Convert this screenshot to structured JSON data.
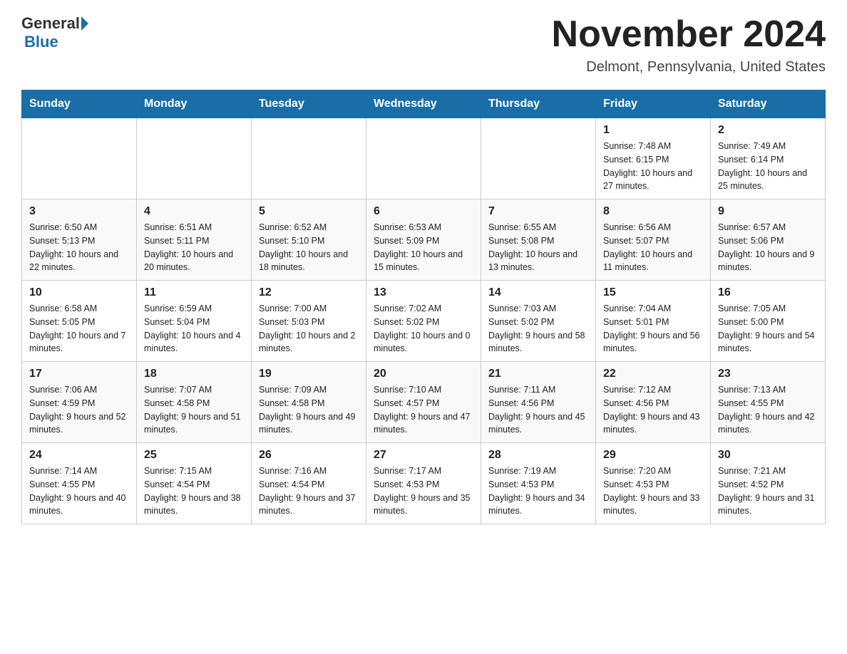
{
  "header": {
    "logo_general": "General",
    "logo_blue": "Blue",
    "month_title": "November 2024",
    "location": "Delmont, Pennsylvania, United States"
  },
  "days_of_week": [
    "Sunday",
    "Monday",
    "Tuesday",
    "Wednesday",
    "Thursday",
    "Friday",
    "Saturday"
  ],
  "weeks": [
    [
      {
        "day": "",
        "info": ""
      },
      {
        "day": "",
        "info": ""
      },
      {
        "day": "",
        "info": ""
      },
      {
        "day": "",
        "info": ""
      },
      {
        "day": "",
        "info": ""
      },
      {
        "day": "1",
        "info": "Sunrise: 7:48 AM\nSunset: 6:15 PM\nDaylight: 10 hours and 27 minutes."
      },
      {
        "day": "2",
        "info": "Sunrise: 7:49 AM\nSunset: 6:14 PM\nDaylight: 10 hours and 25 minutes."
      }
    ],
    [
      {
        "day": "3",
        "info": "Sunrise: 6:50 AM\nSunset: 5:13 PM\nDaylight: 10 hours and 22 minutes."
      },
      {
        "day": "4",
        "info": "Sunrise: 6:51 AM\nSunset: 5:11 PM\nDaylight: 10 hours and 20 minutes."
      },
      {
        "day": "5",
        "info": "Sunrise: 6:52 AM\nSunset: 5:10 PM\nDaylight: 10 hours and 18 minutes."
      },
      {
        "day": "6",
        "info": "Sunrise: 6:53 AM\nSunset: 5:09 PM\nDaylight: 10 hours and 15 minutes."
      },
      {
        "day": "7",
        "info": "Sunrise: 6:55 AM\nSunset: 5:08 PM\nDaylight: 10 hours and 13 minutes."
      },
      {
        "day": "8",
        "info": "Sunrise: 6:56 AM\nSunset: 5:07 PM\nDaylight: 10 hours and 11 minutes."
      },
      {
        "day": "9",
        "info": "Sunrise: 6:57 AM\nSunset: 5:06 PM\nDaylight: 10 hours and 9 minutes."
      }
    ],
    [
      {
        "day": "10",
        "info": "Sunrise: 6:58 AM\nSunset: 5:05 PM\nDaylight: 10 hours and 7 minutes."
      },
      {
        "day": "11",
        "info": "Sunrise: 6:59 AM\nSunset: 5:04 PM\nDaylight: 10 hours and 4 minutes."
      },
      {
        "day": "12",
        "info": "Sunrise: 7:00 AM\nSunset: 5:03 PM\nDaylight: 10 hours and 2 minutes."
      },
      {
        "day": "13",
        "info": "Sunrise: 7:02 AM\nSunset: 5:02 PM\nDaylight: 10 hours and 0 minutes."
      },
      {
        "day": "14",
        "info": "Sunrise: 7:03 AM\nSunset: 5:02 PM\nDaylight: 9 hours and 58 minutes."
      },
      {
        "day": "15",
        "info": "Sunrise: 7:04 AM\nSunset: 5:01 PM\nDaylight: 9 hours and 56 minutes."
      },
      {
        "day": "16",
        "info": "Sunrise: 7:05 AM\nSunset: 5:00 PM\nDaylight: 9 hours and 54 minutes."
      }
    ],
    [
      {
        "day": "17",
        "info": "Sunrise: 7:06 AM\nSunset: 4:59 PM\nDaylight: 9 hours and 52 minutes."
      },
      {
        "day": "18",
        "info": "Sunrise: 7:07 AM\nSunset: 4:58 PM\nDaylight: 9 hours and 51 minutes."
      },
      {
        "day": "19",
        "info": "Sunrise: 7:09 AM\nSunset: 4:58 PM\nDaylight: 9 hours and 49 minutes."
      },
      {
        "day": "20",
        "info": "Sunrise: 7:10 AM\nSunset: 4:57 PM\nDaylight: 9 hours and 47 minutes."
      },
      {
        "day": "21",
        "info": "Sunrise: 7:11 AM\nSunset: 4:56 PM\nDaylight: 9 hours and 45 minutes."
      },
      {
        "day": "22",
        "info": "Sunrise: 7:12 AM\nSunset: 4:56 PM\nDaylight: 9 hours and 43 minutes."
      },
      {
        "day": "23",
        "info": "Sunrise: 7:13 AM\nSunset: 4:55 PM\nDaylight: 9 hours and 42 minutes."
      }
    ],
    [
      {
        "day": "24",
        "info": "Sunrise: 7:14 AM\nSunset: 4:55 PM\nDaylight: 9 hours and 40 minutes."
      },
      {
        "day": "25",
        "info": "Sunrise: 7:15 AM\nSunset: 4:54 PM\nDaylight: 9 hours and 38 minutes."
      },
      {
        "day": "26",
        "info": "Sunrise: 7:16 AM\nSunset: 4:54 PM\nDaylight: 9 hours and 37 minutes."
      },
      {
        "day": "27",
        "info": "Sunrise: 7:17 AM\nSunset: 4:53 PM\nDaylight: 9 hours and 35 minutes."
      },
      {
        "day": "28",
        "info": "Sunrise: 7:19 AM\nSunset: 4:53 PM\nDaylight: 9 hours and 34 minutes."
      },
      {
        "day": "29",
        "info": "Sunrise: 7:20 AM\nSunset: 4:53 PM\nDaylight: 9 hours and 33 minutes."
      },
      {
        "day": "30",
        "info": "Sunrise: 7:21 AM\nSunset: 4:52 PM\nDaylight: 9 hours and 31 minutes."
      }
    ]
  ]
}
